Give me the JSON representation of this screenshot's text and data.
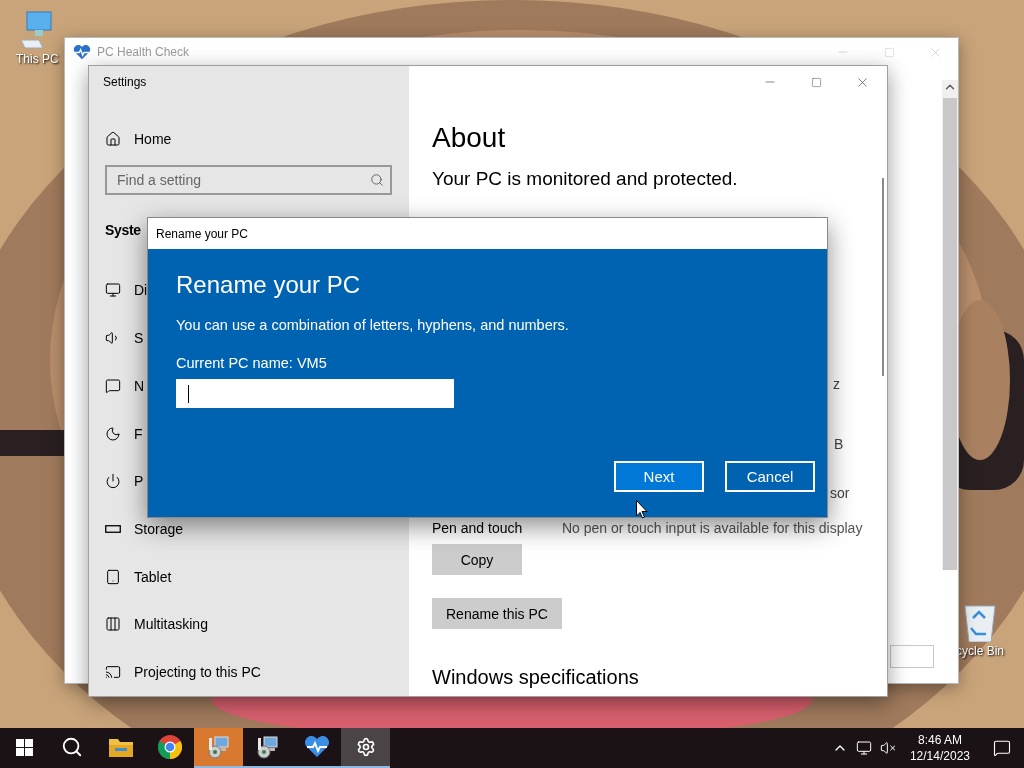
{
  "desktop": {
    "this_pc": {
      "label": "This PC"
    },
    "recycle_bin": {
      "label": "cycle Bin"
    }
  },
  "health_check_window": {
    "title": "PC Health Check"
  },
  "settings_window": {
    "title": "Settings",
    "sidebar": {
      "home": "Home",
      "search": {
        "placeholder": "Find a setting"
      },
      "section": "Syste",
      "items": [
        {
          "label": "Di",
          "kind": "display"
        },
        {
          "label": "S",
          "kind": "sound"
        },
        {
          "label": "N",
          "kind": "notifications"
        },
        {
          "label": "F",
          "kind": "focus"
        },
        {
          "label": "P",
          "kind": "power"
        },
        {
          "label": "Storage",
          "kind": "storage"
        },
        {
          "label": "Tablet",
          "kind": "tablet"
        },
        {
          "label": "Multitasking",
          "kind": "multitasking"
        },
        {
          "label": "Projecting to this PC",
          "kind": "projecting"
        }
      ]
    },
    "about": {
      "heading": "About",
      "status": "Your PC is monitored and protected.",
      "fragments": [
        "z",
        "B",
        "sor"
      ],
      "spec_row": {
        "label": "Pen and touch",
        "value": "No pen or touch input is available for this display"
      },
      "buttons": [
        "Copy",
        "Rename this PC"
      ],
      "section": "Windows specifications"
    }
  },
  "dialog": {
    "title": "Rename your PC",
    "heading": "Rename your PC",
    "description": "You can use a combination of letters, hyphens, and numbers.",
    "current_name": "Current PC name: VM5",
    "buttons": [
      {
        "label": "Next",
        "selected": true
      },
      {
        "label": "Cancel",
        "selected": false
      }
    ]
  },
  "taskbar": {
    "apps": [
      {
        "kind": "start",
        "selected": false,
        "running": false,
        "flashing": false
      },
      {
        "kind": "search",
        "selected": false,
        "running": false,
        "flashing": false
      },
      {
        "kind": "folder",
        "selected": false,
        "running": false,
        "flashing": false
      },
      {
        "kind": "browser",
        "selected": false,
        "running": false,
        "flashing": false
      },
      {
        "kind": "installer",
        "selected": false,
        "running": true,
        "flashing": true
      },
      {
        "kind": "installer",
        "selected": false,
        "running": true,
        "flashing": false
      },
      {
        "kind": "health",
        "selected": false,
        "running": true,
        "flashing": false
      },
      {
        "kind": "settings",
        "selected": true,
        "running": true,
        "flashing": false
      }
    ],
    "time": "8:46 AM",
    "date": "12/14/2023"
  }
}
